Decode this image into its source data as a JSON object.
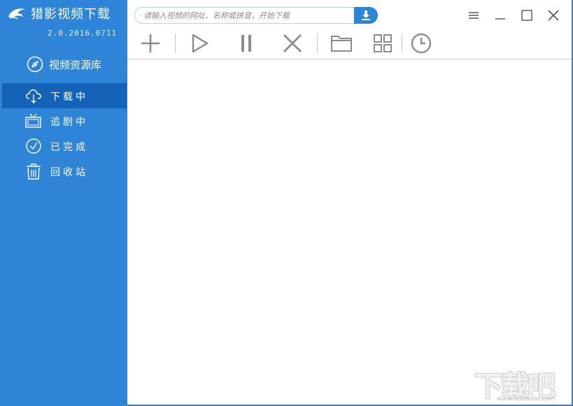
{
  "app": {
    "title": "猎影视频下载",
    "version": "2.0.2016.0711"
  },
  "sidebar": {
    "library_label": "视频资源库",
    "items": [
      {
        "label": "下载中",
        "icon": "cloud-download-icon",
        "active": true
      },
      {
        "label": "追剧中",
        "icon": "tv-icon",
        "active": false
      },
      {
        "label": "已完成",
        "icon": "check-circle-icon",
        "active": false
      },
      {
        "label": "回收站",
        "icon": "trash-icon",
        "active": false
      }
    ]
  },
  "search": {
    "placeholder": "请输入视频的网址、名称或拼音，开始下载",
    "value": ""
  },
  "toolbar": {
    "buttons": [
      "add-icon",
      "play-icon",
      "pause-icon",
      "delete-icon",
      "folder-icon",
      "grid-icon",
      "clock-icon"
    ]
  },
  "window_controls": [
    "menu-icon",
    "minimize-icon",
    "maximize-icon",
    "close-icon"
  ],
  "watermark": {
    "text": "下载吧",
    "url": "www.xiazaiba.com"
  },
  "colors": {
    "sidebar": "#2e84d6",
    "active_item": "#1563b8",
    "icon_gray": "#8c8c8c"
  }
}
